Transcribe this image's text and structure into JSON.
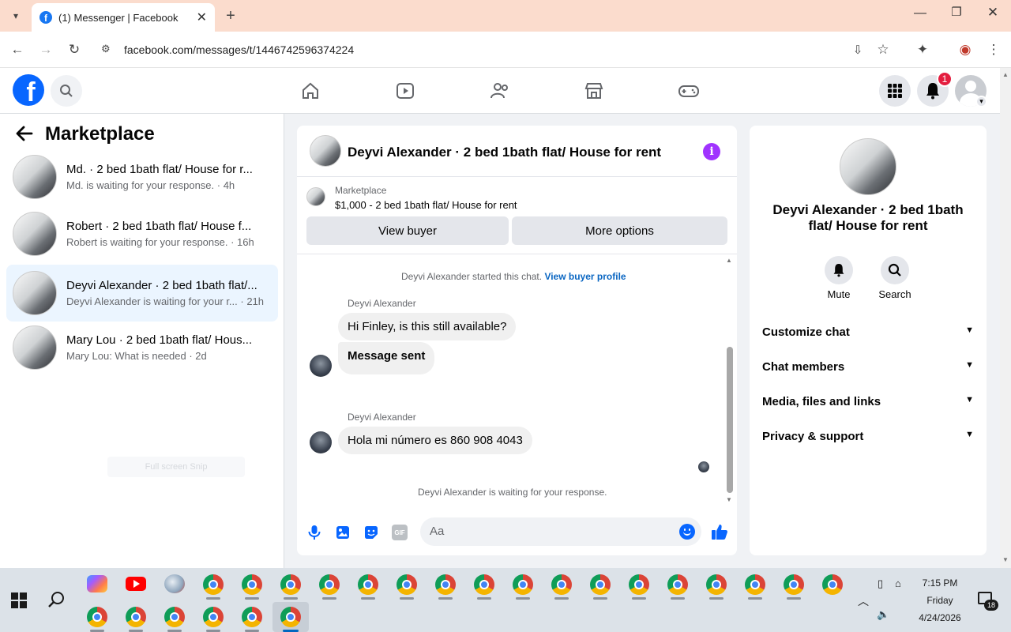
{
  "browser": {
    "tab_title": "(1) Messenger | Facebook",
    "url": "facebook.com/messages/t/1446742596374224"
  },
  "fbheader": {
    "notification_count": "1"
  },
  "left": {
    "title": "Marketplace",
    "conversations": [
      {
        "title": "Md. · 2 bed 1bath flat/ House for r...",
        "subtitle": "Md. is waiting for your response. · 4h",
        "selected": false
      },
      {
        "title": "Robert · 2 bed 1bath flat/ House f...",
        "subtitle": "Robert is waiting for your response. · 16h",
        "selected": false
      },
      {
        "title": "Deyvi Alexander · 2 bed 1bath flat/...",
        "subtitle": "Deyvi Alexander is waiting for your r... · 21h",
        "selected": true
      },
      {
        "title": "Mary Lou · 2 bed 1bath flat/ Hous...",
        "subtitle": "Mary Lou: What is needed · 2d",
        "selected": false
      }
    ],
    "faint_label": "Full screen Snip"
  },
  "chat": {
    "header_title": "Deyvi Alexander · 2 bed 1bath flat/ House for rent",
    "listing_source": "Marketplace",
    "listing_price_title": "$1,000 - 2 bed 1bath flat/ House for rent",
    "view_buyer": "View buyer",
    "more_options": "More options",
    "started_text": "Deyvi Alexander started this chat.",
    "view_buyer_profile": "View buyer profile",
    "sender_name_1": "Deyvi Alexander",
    "msg1": "Hi Finley, is this still available?",
    "msg2": "Message sent",
    "sender_name_2": "Deyvi Alexander",
    "msg3": "Hola mi número es 860 908 4043",
    "waiting": "Deyvi Alexander is waiting for your response.",
    "input_placeholder": "Aa",
    "gif_label": "GIF"
  },
  "right": {
    "name": "Deyvi Alexander · 2 bed 1bath flat/ House for rent",
    "mute": "Mute",
    "search": "Search",
    "sections": [
      "Customize chat",
      "Chat members",
      "Media, files and links",
      "Privacy & support"
    ]
  },
  "taskbar": {
    "time": "7:15 PM",
    "day": "Friday",
    "date": "4/24/2026",
    "notif_count": "18"
  }
}
